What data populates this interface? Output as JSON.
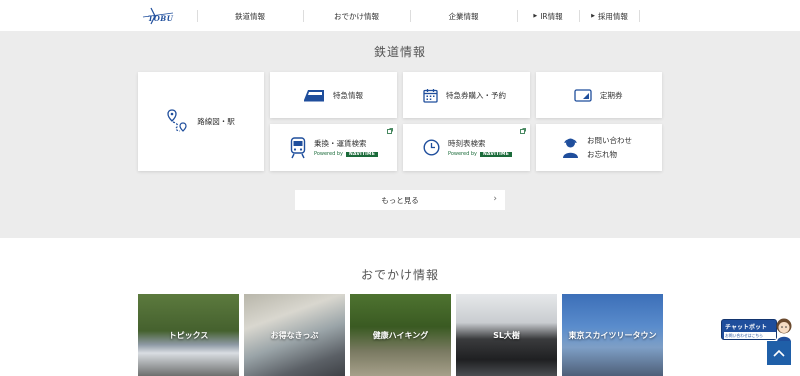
{
  "header": {
    "logo_text": "TOBU",
    "nav": [
      {
        "label": "鉄道情報"
      },
      {
        "label": "おでかけ情報"
      },
      {
        "label": "企業情報"
      },
      {
        "label": "IR情報"
      },
      {
        "label": "採用情報"
      }
    ]
  },
  "railway": {
    "title": "鉄道情報",
    "cards": {
      "route_map": "路線図・駅",
      "limited_express": "特急情報",
      "limited_express_ticket": "特急券購入・予約",
      "commuter_pass": "定期券",
      "transfer_search": "乗換・運賃検索",
      "timetable_search": "時刻表検索",
      "powered_by": "Powered by",
      "navitime": "NAVITIME",
      "contact_line1": "お問い合わせ",
      "contact_line2": "お忘れ物"
    },
    "more_label": "もっと見る"
  },
  "outing": {
    "title": "おでかけ情報",
    "photos": [
      {
        "caption": "トピックス"
      },
      {
        "caption": "お得なきっぷ"
      },
      {
        "caption": "健康ハイキング"
      },
      {
        "caption": "SL大樹"
      },
      {
        "caption": "東京スカイツリータウン"
      }
    ]
  },
  "chatbot": {
    "title": "チャットボット",
    "subtitle": "お問い合わせはこちら"
  },
  "colors": {
    "brand_blue": "#1f4e9c",
    "navitime_green": "#1b6b3a",
    "section_bg": "#ececec"
  }
}
